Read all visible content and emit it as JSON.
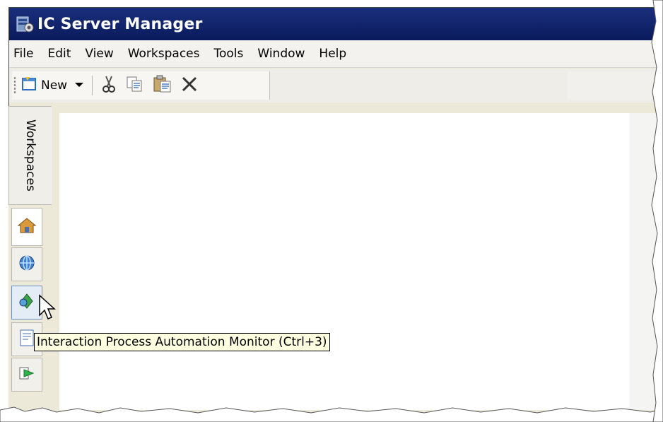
{
  "window": {
    "title": "IC Server Manager",
    "title_bar_color": "#0a1a5c"
  },
  "menubar": {
    "items": [
      "File",
      "Edit",
      "View",
      "Workspaces",
      "Tools",
      "Window",
      "Help"
    ]
  },
  "toolbar": {
    "new_label": "New",
    "icons": [
      "new-document-icon",
      "dropdown-arrow-icon",
      "cut-icon",
      "copy-icon",
      "paste-icon",
      "delete-icon"
    ]
  },
  "sidebar": {
    "workspaces_label": "Workspaces",
    "buttons": [
      "home-icon",
      "globe-icon",
      "process-automation-icon",
      "document-icon",
      "green-arrow-icon"
    ]
  },
  "tooltip": {
    "text": "Interaction Process Automation Monitor (Ctrl+3)"
  }
}
